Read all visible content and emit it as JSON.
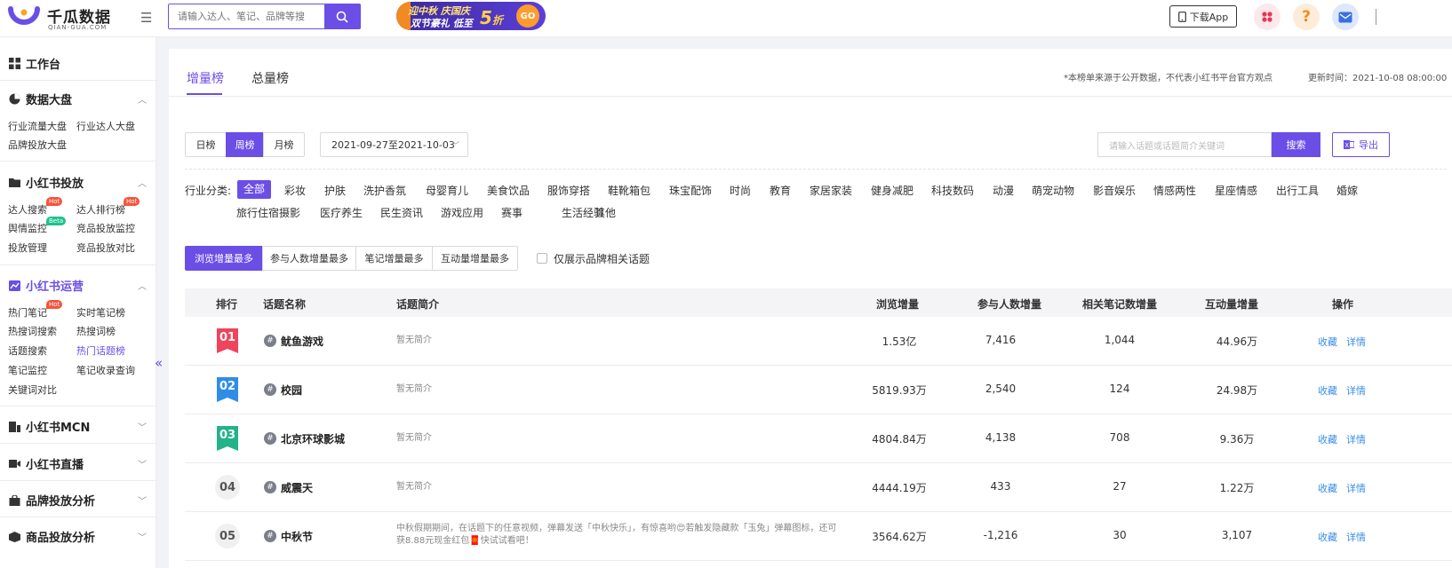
{
  "app": {
    "logo_cn": "千瓜数据",
    "logo_en": "QIAN-GUA.COM",
    "search_placeholder": "请输入达人、笔记、品牌等搜",
    "banner_line1": "迎中秋 庆国庆",
    "banner_line2": "双节豪礼 低至",
    "banner_num": "5",
    "banner_unit": "折",
    "banner_go": "GO",
    "download_label": "下载App",
    "colors": {
      "accent": "#6b4ee6",
      "hot": "#f5543c",
      "beta": "#1dc38b",
      "link": "#3a8ee6"
    },
    "icons": [
      "menu-toggle-icon",
      "search-icon",
      "phone-icon",
      "apps-icon",
      "help-icon",
      "mail-icon"
    ]
  },
  "sidebar": {
    "workbench": "工作台",
    "sections": [
      {
        "title": "数据大盘",
        "items": [
          "行业流量大盘",
          "行业达人大盘",
          "品牌投放大盘"
        ]
      },
      {
        "title": "小红书投放",
        "items": [
          "达人搜索",
          "达人排行榜",
          "舆情监控",
          "竞品投放监控",
          "投放管理",
          "竞品投放对比"
        ]
      },
      {
        "title": "小红书运营",
        "items": [
          "热门笔记",
          "实时笔记榜",
          "热搜词搜索",
          "热搜词榜",
          "话题搜索",
          "热门话题榜",
          "笔记监控",
          "笔记收录查询",
          "关键词对比"
        ]
      },
      {
        "title": "小红书MCN"
      },
      {
        "title": "小红书直播"
      },
      {
        "title": "品牌投放分析"
      },
      {
        "title": "商品投放分析"
      }
    ],
    "badge_hot": "Hot",
    "badge_beta": "Beta",
    "collapse_glyph": "«"
  },
  "main": {
    "tabs": [
      "增量榜",
      "总量榜"
    ],
    "note": "*本榜单来源于公开数据，不代表小红书平台官方观点",
    "update_time": "更新时间：2021-10-08 08:00:00",
    "periods": [
      "日榜",
      "周榜",
      "月榜"
    ],
    "date_range": "2021-09-27至2021-10-03",
    "keyword_placeholder": "请输入话题或话题简介关键词",
    "search_btn": "搜索",
    "export_btn": "导出",
    "category_label": "行业分类:",
    "categories": [
      "全部",
      "彩妆",
      "护肤",
      "洗护香氛",
      "母婴育儿",
      "美食饮品",
      "服饰穿搭",
      "鞋靴箱包",
      "珠宝配饰",
      "时尚",
      "教育",
      "家居家装",
      "健身减肥",
      "科技数码",
      "动漫",
      "萌宠动物",
      "影音娱乐",
      "情感两性",
      "星座情感",
      "出行工具",
      "婚嫁",
      "旅行住宿",
      "摄影",
      "医疗养生",
      "民生资讯",
      "游戏应用",
      "赛事",
      "生活经验",
      "其他"
    ],
    "sorts": [
      "浏览增量最多",
      "参与人数增量最多",
      "笔记增量最多",
      "互动量增量最多"
    ],
    "brand_only_label": "仅展示品牌相关话题"
  },
  "table": {
    "headers": [
      "排行",
      "话题名称",
      "话题简介",
      "浏览增量",
      "参与人数增量",
      "相关笔记数增量",
      "互动量增量",
      "操作"
    ],
    "rows": [
      {
        "rank": "01",
        "name": "鱿鱼游戏",
        "desc": "暂无简介",
        "views": "1.53亿",
        "participants": "7,416",
        "notes": "1,044",
        "interactions": "44.96万"
      },
      {
        "rank": "02",
        "name": "校园",
        "desc": "暂无简介",
        "views": "5819.93万",
        "participants": "2,540",
        "notes": "124",
        "interactions": "24.98万"
      },
      {
        "rank": "03",
        "name": "北京环球影城",
        "desc": "暂无简介",
        "views": "4804.84万",
        "participants": "4,138",
        "notes": "708",
        "interactions": "9.36万"
      },
      {
        "rank": "04",
        "name": "威震天",
        "desc": "暂无简介",
        "views": "4444.19万",
        "participants": "433",
        "notes": "27",
        "interactions": "1.22万"
      },
      {
        "rank": "05",
        "name": "中秋节",
        "desc": "中秋假期期间，在话题下的任意视频，弹幕发送「中秋快乐」，有惊喜哟😍若触发隐藏款「玉兔」弹幕图标，还可获8.88元现金红包🧧快试试看吧！",
        "views": "3564.62万",
        "participants": "-1,216",
        "notes": "30",
        "interactions": "3,107"
      }
    ],
    "action_fav": "收藏",
    "action_detail": "详情"
  }
}
